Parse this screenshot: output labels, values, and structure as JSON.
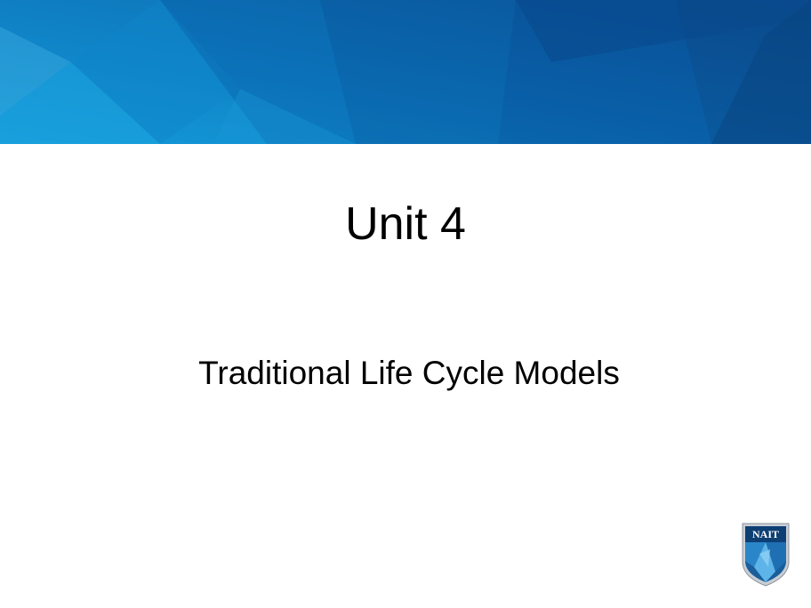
{
  "slide": {
    "title": "Unit 4",
    "subtitle": "Traditional Life Cycle Models"
  },
  "logo": {
    "text": "NAIT",
    "icon": "nait-shield-logo"
  },
  "colors": {
    "banner_dark": "#0a4d8f",
    "banner_mid": "#0d6bb3",
    "banner_light": "#159ad8",
    "text": "#000000",
    "background": "#ffffff"
  }
}
